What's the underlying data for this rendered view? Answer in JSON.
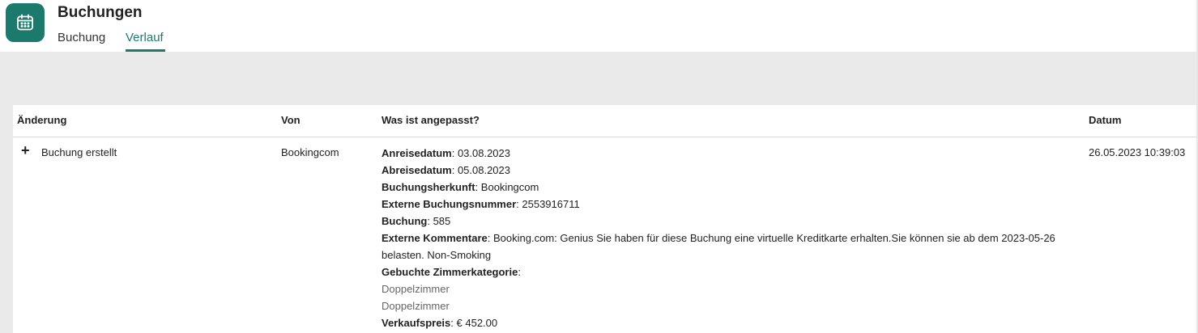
{
  "app": {
    "icon": "calendar-icon",
    "title": "Buchungen",
    "accent_color": "#1c7a6c"
  },
  "tabs": [
    {
      "label": "Buchung",
      "active": false
    },
    {
      "label": "Verlauf",
      "active": true
    }
  ],
  "table": {
    "headers": {
      "change": "Änderung",
      "from": "Von",
      "what": "Was ist angepasst?",
      "date": "Datum"
    },
    "rows": [
      {
        "icon": "plus-icon",
        "change": "Buchung erstellt",
        "from": "Bookingcom",
        "date": "26.05.2023 10:39:03",
        "fields": {
          "arrival_label": "Anreisedatum",
          "arrival_value": "03.08.2023",
          "departure_label": "Abreisedatum",
          "departure_value": "05.08.2023",
          "source_label": "Buchungsherkunft",
          "source_value": "Bookingcom",
          "ext_number_label": "Externe Buchungsnummer",
          "ext_number_value": "2553916711",
          "booking_label": "Buchung",
          "booking_value": "585",
          "ext_comments_label": "Externe Kommentare",
          "ext_comments_value": "Booking.com: Genius Sie haben für diese Buchung eine virtuelle Kreditkarte erhalten.Sie können sie ab dem 2023-05-26 belasten. Non-Smoking",
          "room_category_label": "Gebuchte Zimmerkategorie",
          "room_1": "Doppelzimmer",
          "room_2": "Doppelzimmer",
          "price_label": "Verkaufspreis",
          "price_value": "€ 452.00"
        }
      }
    ]
  }
}
